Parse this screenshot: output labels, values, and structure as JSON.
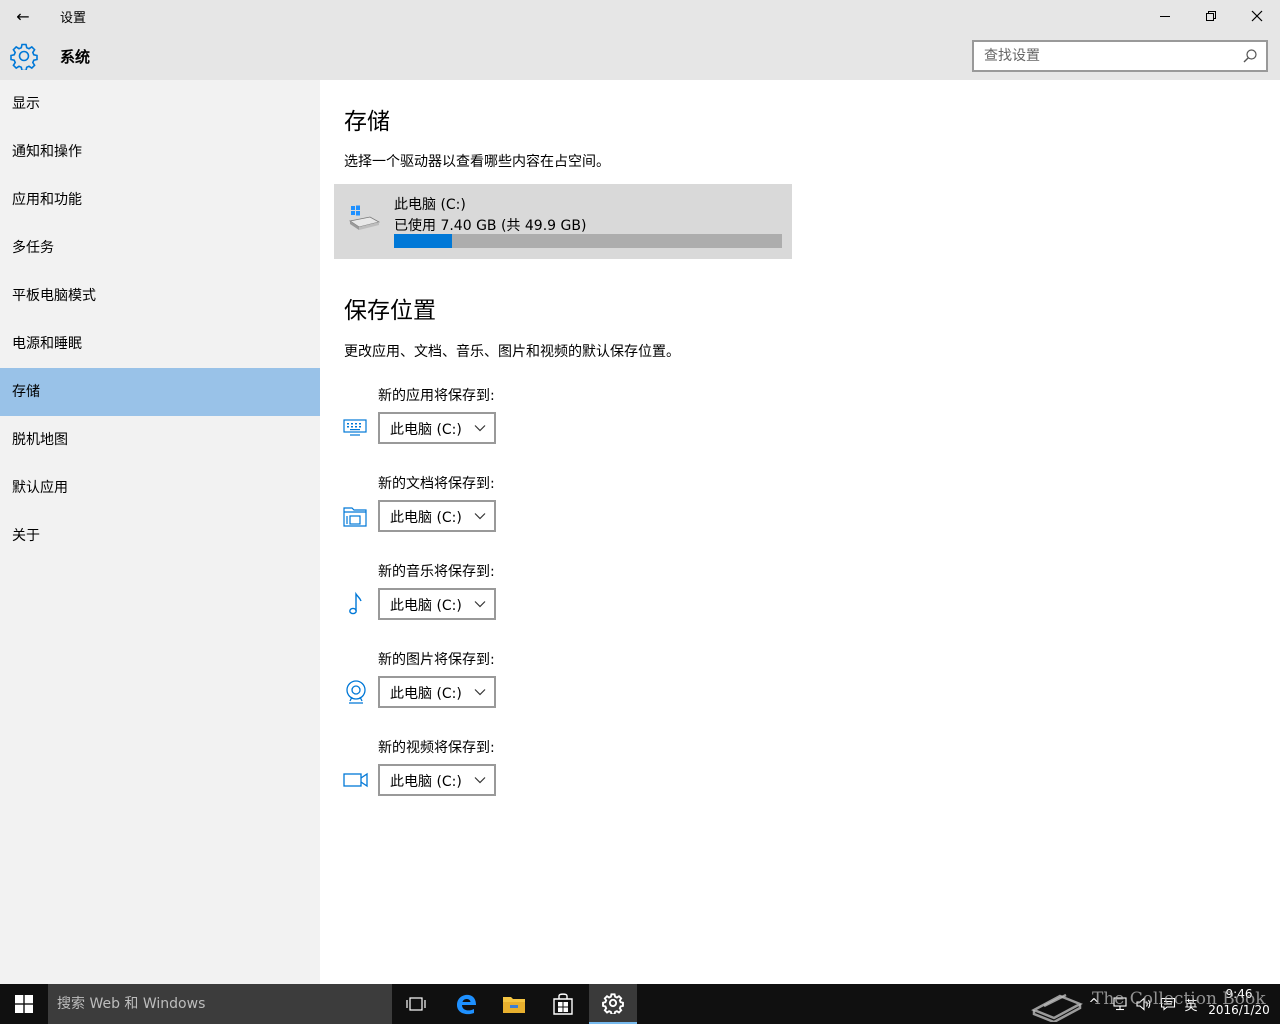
{
  "window": {
    "title": "设置",
    "back_icon": "←",
    "minimize_icon": "—",
    "maximize_icon": "❐",
    "close_icon": "✕"
  },
  "header": {
    "title": "系统",
    "search_placeholder": "查找设置"
  },
  "sidebar": {
    "items": [
      {
        "label": "显示"
      },
      {
        "label": "通知和操作"
      },
      {
        "label": "应用和功能"
      },
      {
        "label": "多任务"
      },
      {
        "label": "平板电脑模式"
      },
      {
        "label": "电源和睡眠"
      },
      {
        "label": "存储",
        "selected": true
      },
      {
        "label": "脱机地图"
      },
      {
        "label": "默认应用"
      },
      {
        "label": "关于"
      }
    ]
  },
  "storage": {
    "heading": "存储",
    "description": "选择一个驱动器以查看哪些内容在占空间。",
    "drive": {
      "name": "此电脑 (C:)",
      "usage_text": "已使用 7.40 GB (共 49.9 GB)",
      "used_gb": 7.4,
      "total_gb": 49.9
    }
  },
  "save_locations": {
    "heading": "保存位置",
    "description": "更改应用、文档、音乐、图片和视频的默认保存位置。",
    "items": [
      {
        "label": "新的应用将保存到:",
        "value": "此电脑 (C:)",
        "icon": "apps-icon"
      },
      {
        "label": "新的文档将保存到:",
        "value": "此电脑 (C:)",
        "icon": "documents-icon"
      },
      {
        "label": "新的音乐将保存到:",
        "value": "此电脑 (C:)",
        "icon": "music-icon"
      },
      {
        "label": "新的图片将保存到:",
        "value": "此电脑 (C:)",
        "icon": "pictures-icon"
      },
      {
        "label": "新的视频将保存到:",
        "value": "此电脑 (C:)",
        "icon": "videos-icon"
      }
    ]
  },
  "taskbar": {
    "search_text": "搜索 Web 和 Windows",
    "tray_chevron": "^",
    "tray_input": "英",
    "time": "9:46",
    "date": "2016/1/20"
  },
  "watermark": {
    "text": "The Collection Book"
  },
  "colors": {
    "accent": "#0078d7",
    "selected_nav": "#99c2e8",
    "chrome": "#e6e6e6",
    "sidebar": "#f2f2f2",
    "taskbar": "#101010"
  }
}
